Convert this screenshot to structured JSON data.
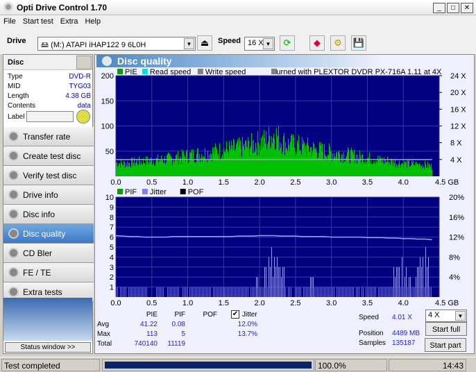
{
  "window": {
    "title": "Opti Drive Control 1.70",
    "buttons": [
      "_",
      "□",
      "✕"
    ]
  },
  "menu": [
    "File",
    "Start test",
    "Extra",
    "Help"
  ],
  "toolbar": {
    "drive_label": "Drive",
    "drive_value": "(M:)   ATAPI iHAP122   9 6L0H",
    "speed_label": "Speed",
    "speed_value": "16 X"
  },
  "disc": {
    "header": "Disc",
    "rows": [
      {
        "k": "Type",
        "v": "DVD-R"
      },
      {
        "k": "MID",
        "v": "TYG03"
      },
      {
        "k": "Length",
        "v": "4.38 GB"
      },
      {
        "k": "Contents",
        "v": "data"
      }
    ],
    "label_label": "Label",
    "label_value": ""
  },
  "nav": [
    "Transfer rate",
    "Create test disc",
    "Verify test disc",
    "Drive info",
    "Disc info",
    "Disc quality",
    "CD Bler",
    "FE / TE",
    "Extra tests"
  ],
  "nav_selected": "Disc quality",
  "status_window_label": "Status window >>",
  "panel_title": "Disc quality",
  "chart_data": [
    {
      "type": "bar",
      "legend": [
        "PIE",
        "Read speed",
        "Write speed"
      ],
      "legend_colors": [
        "#00a000",
        "#00e0e0",
        "#808080"
      ],
      "annotation": "Burned with PLEXTOR DVDR   PX-716A 1.11 at 4X",
      "x_ticks": [
        "0.0",
        "0.5",
        "1.0",
        "1.5",
        "2.0",
        "2.5",
        "3.0",
        "3.5",
        "4.0",
        "4.5 GB"
      ],
      "xlim": [
        0,
        4.5
      ],
      "y_ticks": [
        "200",
        "150",
        "100",
        "50"
      ],
      "ylim": [
        0,
        200
      ],
      "y2_ticks": [
        "24 X",
        "20 X",
        "16 X",
        "12 X",
        "8 X",
        "4 X"
      ],
      "y2lim": [
        0,
        24
      ],
      "x_step_gb": 0.1,
      "pie": [
        30,
        28,
        30,
        32,
        33,
        35,
        36,
        38,
        40,
        42,
        45,
        48,
        50,
        52,
        55,
        58,
        60,
        62,
        65,
        70,
        75,
        80,
        95,
        78,
        70,
        68,
        65,
        62,
        58,
        55,
        52,
        50,
        48,
        45,
        42,
        40,
        38,
        35,
        33,
        30,
        28,
        27,
        26,
        25,
        22
      ],
      "read_speed_x": 4.0
    },
    {
      "type": "bar",
      "legend": [
        "PIF",
        "Jitter",
        "POF"
      ],
      "legend_colors": [
        "#00a000",
        "#8080ff",
        "#000000"
      ],
      "x_ticks": [
        "0.0",
        "0.5",
        "1.0",
        "1.5",
        "2.0",
        "2.5",
        "3.0",
        "3.5",
        "4.0",
        "4.5 GB"
      ],
      "xlim": [
        0,
        4.5
      ],
      "y_ticks": [
        "10",
        "9",
        "8",
        "7",
        "6",
        "5",
        "4",
        "3",
        "2",
        "1"
      ],
      "ylim": [
        0,
        10
      ],
      "y2_ticks": [
        "20%",
        "16%",
        "12%",
        "8%",
        "4%"
      ],
      "y2lim": [
        0,
        20
      ],
      "x_step_gb": 0.1,
      "pif": [
        1,
        1,
        1,
        1,
        1,
        0,
        1,
        1,
        1,
        1,
        1,
        1,
        1,
        1,
        1,
        1,
        1,
        1,
        1,
        1,
        2,
        4,
        5,
        3,
        1,
        1,
        1,
        2,
        1,
        1,
        1,
        1,
        1,
        1,
        1,
        1,
        1,
        1,
        1,
        3,
        5,
        2,
        4,
        5,
        1
      ],
      "jitter_pct": [
        12.3,
        12.2,
        12.1,
        12.1,
        12.0,
        12.0,
        12.0,
        12.0,
        12.1,
        12.1,
        12.1,
        12.1,
        12.1,
        12.1,
        12.1,
        12.1,
        12.1,
        12.2,
        12.2,
        12.2,
        12.3,
        12.3,
        12.3,
        12.2,
        12.2,
        12.2,
        12.1,
        12.1,
        12.1,
        12.1,
        12.0,
        12.0,
        12.0,
        12.0,
        12.0,
        11.9,
        11.9,
        11.9,
        11.8,
        11.8,
        11.7,
        11.7,
        11.6,
        11.6,
        11.5
      ]
    }
  ],
  "stats": {
    "headers": [
      "PIE",
      "PIF",
      "POF"
    ],
    "jitter_label": "Jitter",
    "jitter_checked": true,
    "rows": [
      {
        "k": "Avg",
        "pie": "41.22",
        "pif": "0.08",
        "pof": "",
        "jit": "12.0%"
      },
      {
        "k": "Max",
        "pie": "113",
        "pif": "5",
        "pof": "",
        "jit": "13.7%"
      },
      {
        "k": "Total",
        "pie": "740140",
        "pif": "11119",
        "pof": "",
        "jit": ""
      }
    ]
  },
  "right": {
    "speed_label": "Speed",
    "speed_value": "4.01 X",
    "speed_select": "4 X",
    "position_label": "Position",
    "position_value": "4489 MB",
    "samples_label": "Samples",
    "samples_value": "135187",
    "start_full": "Start full",
    "start_part": "Start part"
  },
  "statusbar": {
    "text": "Test completed",
    "progress": 100.0,
    "progress_label": "100.0%",
    "time": "14:43"
  }
}
